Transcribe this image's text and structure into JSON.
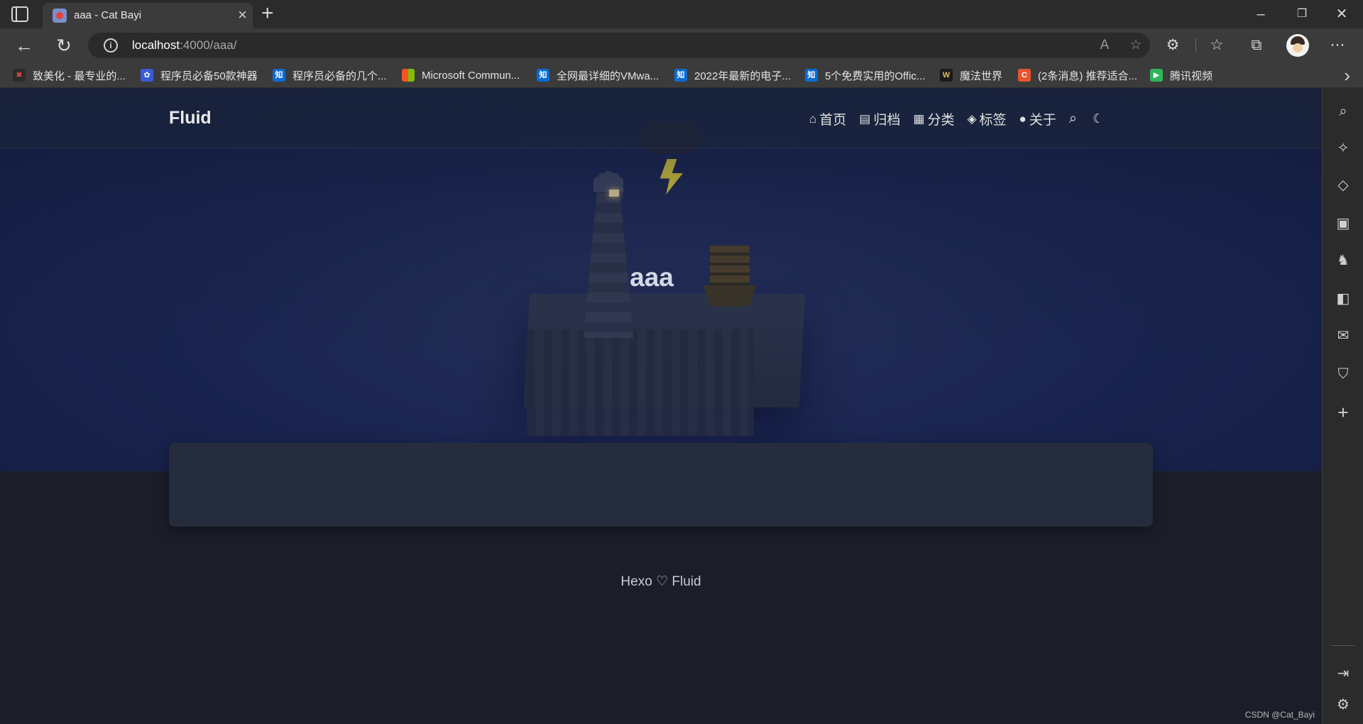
{
  "browser": {
    "tab_title": "aaa - Cat Bayi",
    "url_host": "localhost",
    "url_path": ":4000/aaa/",
    "bookmarks": [
      {
        "label": "致美化 - 最专业的...",
        "icon": "zhimeihua-icon",
        "color": "#2b2b2b"
      },
      {
        "label": "程序员必备50款神器",
        "icon": "paw-icon",
        "color": "#3a5bd9"
      },
      {
        "label": "程序员必备的几个...",
        "icon": "zhihu-icon",
        "color": "#0b6bd3"
      },
      {
        "label": "Microsoft Commun...",
        "icon": "microsoft-icon",
        "color": "#f35325"
      },
      {
        "label": "全网最详细的VMwa...",
        "icon": "zhihu-icon",
        "color": "#0b6bd3"
      },
      {
        "label": "2022年最新的电子...",
        "icon": "zhihu-icon",
        "color": "#0b6bd3"
      },
      {
        "label": "5个免费实用的Offic...",
        "icon": "zhihu-icon",
        "color": "#0b6bd3"
      },
      {
        "label": "魔法世界",
        "icon": "w-icon",
        "color": "#1a1a1a"
      },
      {
        "label": "(2条消息) 推荐适合...",
        "icon": "csdn-icon",
        "color": "#e8542c"
      },
      {
        "label": "腾讯视频",
        "icon": "tencent-video-icon",
        "color": "#2fb55b"
      }
    ]
  },
  "site": {
    "brand": "Fluid",
    "nav": [
      {
        "label": "首页",
        "icon": "home-icon"
      },
      {
        "label": "归档",
        "icon": "archive-icon"
      },
      {
        "label": "分类",
        "icon": "category-icon"
      },
      {
        "label": "标签",
        "icon": "tag-icon"
      },
      {
        "label": "关于",
        "icon": "user-icon"
      }
    ],
    "post_title": "aaa",
    "footer": {
      "left": "Hexo",
      "heart": "♡",
      "right": "Fluid"
    },
    "watermark": "CSDN @Cat_Bayi"
  },
  "colors": {
    "page_bg": "#1b1e29",
    "banner": "#1a2550",
    "card": "#252c3b",
    "bolt": "#cfc13a"
  }
}
